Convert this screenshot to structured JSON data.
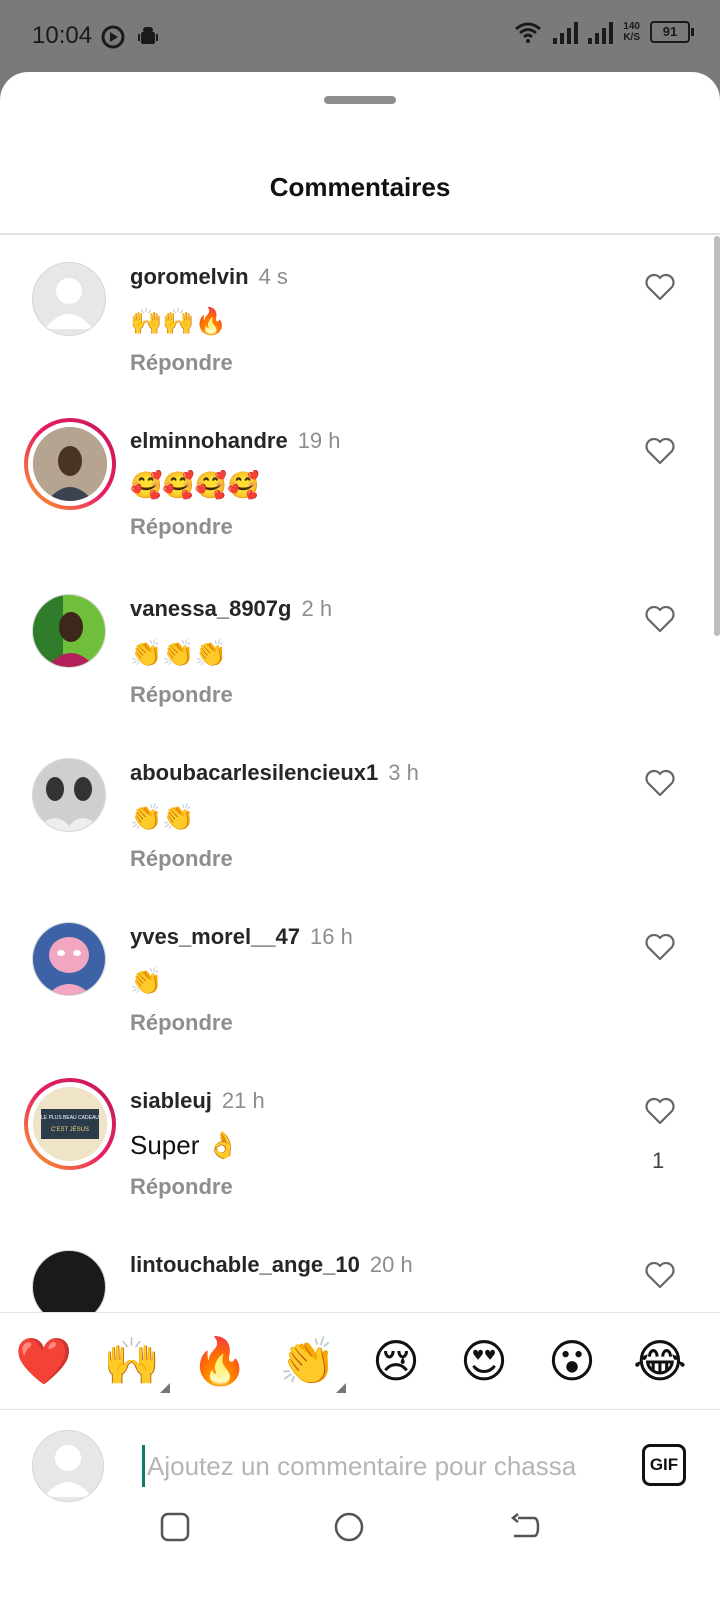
{
  "status_bar": {
    "time": "10:04",
    "speed_value": "140",
    "speed_unit": "K/S",
    "battery": "91"
  },
  "sheet": {
    "title": "Commentaires"
  },
  "comments": [
    {
      "username": "goromelvin",
      "time": "4 s",
      "text": "🙌🙌🔥",
      "reply": "Répondre",
      "likes": "",
      "avatar": "default"
    },
    {
      "username": "elminnohandre",
      "time": "19 h",
      "text": "🥰🥰🥰🥰",
      "reply": "Répondre",
      "likes": "",
      "avatar": "story"
    },
    {
      "username": "vanessa_8907g",
      "time": "2 h",
      "text": "👏👏👏",
      "reply": "Répondre",
      "likes": "",
      "avatar": "photo"
    },
    {
      "username": "aboubacarlesilencieux1",
      "time": "3 h",
      "text": "👏👏",
      "reply": "Répondre",
      "likes": "",
      "avatar": "photo"
    },
    {
      "username": "yves_morel__47",
      "time": "16 h",
      "text": "👏",
      "reply": "Répondre",
      "likes": "",
      "avatar": "photo"
    },
    {
      "username": "siableuj",
      "time": "21 h",
      "text": "Super 👌",
      "reply": "Répondre",
      "likes": "1",
      "avatar": "story"
    },
    {
      "username": "lintouchable_ange_10",
      "time": "20 h",
      "text": "",
      "reply": "",
      "likes": "",
      "avatar": "photo"
    }
  ],
  "avatar_texts": {
    "siableuj_line1": "LE PLUS BEAU CADEAU",
    "siableuj_line2": "C'EST JÉSUS"
  },
  "emoji_bar": [
    "❤️",
    "🙌",
    "🔥",
    "👏",
    "😢",
    "😍",
    "😮",
    "😂"
  ],
  "input": {
    "placeholder": "Ajoutez un commentaire pour chassa",
    "gif_label": "GIF"
  },
  "colors": {
    "accent_cursor": "#0e7c6b",
    "secondary_text": "#8e8e8e",
    "story_ring_start": "#f9a825",
    "story_ring_end": "#c2185b"
  }
}
